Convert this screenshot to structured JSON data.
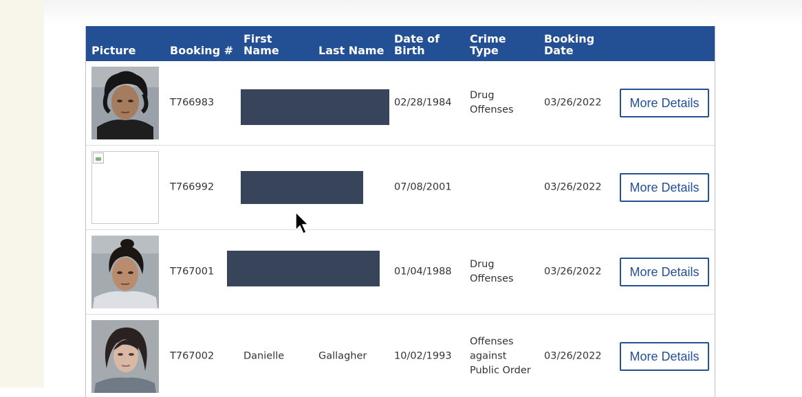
{
  "table": {
    "headers": {
      "picture": "Picture",
      "booking": "Booking #",
      "first_name": [
        "First",
        "Name"
      ],
      "last_name": "Last Name",
      "dob": [
        "Date of",
        "Birth"
      ],
      "crime": [
        "Crime",
        "Type"
      ],
      "booking_date": [
        "Booking",
        "Date"
      ]
    },
    "rows": [
      {
        "booking": "T766983",
        "first_name": "",
        "last_name": "",
        "dob": "02/28/1984",
        "crime": [
          "Drug",
          "Offenses"
        ],
        "booking_date": "03/26/2022",
        "button": "More Details"
      },
      {
        "booking": "T766992",
        "first_name": "",
        "last_name": "",
        "dob": "07/08/2001",
        "crime": [],
        "booking_date": "03/26/2022",
        "button": "More Details"
      },
      {
        "booking": "T767001",
        "first_name": "",
        "last_name": "",
        "dob": "01/04/1988",
        "crime": [
          "Drug",
          "Offenses"
        ],
        "booking_date": "03/26/2022",
        "button": "More Details"
      },
      {
        "booking": "T767002",
        "first_name": "Danielle",
        "last_name": "Gallagher",
        "dob": "10/02/1993",
        "crime": [
          "Offenses",
          "against",
          "Public Order"
        ],
        "booking_date": "03/26/2022",
        "button": "More Details"
      }
    ]
  },
  "colors": {
    "header_bg": "#234f95",
    "redaction": "#38445a",
    "page_side": "#f8f5ea"
  },
  "icons": {
    "broken_image": "broken-image-icon",
    "cursor": "mouse-cursor-icon"
  }
}
